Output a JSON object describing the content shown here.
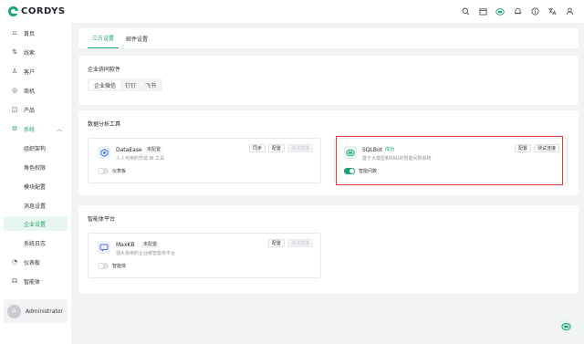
{
  "app": {
    "logo_text": "CORDYS"
  },
  "topbar": {
    "icons": [
      "search-icon",
      "calendar-icon",
      "sqlbot-icon",
      "bell-icon",
      "info-icon",
      "translate-icon",
      "user-icon"
    ]
  },
  "sidebar": {
    "items": [
      {
        "label": "首页",
        "icon": "home-icon"
      },
      {
        "label": "线索",
        "icon": "lead-icon"
      },
      {
        "label": "客户",
        "icon": "customer-icon"
      },
      {
        "label": "商机",
        "icon": "opportunity-icon"
      },
      {
        "label": "产品",
        "icon": "product-icon"
      },
      {
        "label": "系统",
        "icon": "settings-icon"
      }
    ],
    "sub_items": [
      {
        "label": "组织架构"
      },
      {
        "label": "角色权限"
      },
      {
        "label": "模块配置"
      },
      {
        "label": "消息设置"
      },
      {
        "label": "企业设置"
      },
      {
        "label": "系统日志"
      }
    ],
    "bottom_items": [
      {
        "label": "仪表板",
        "icon": "dashboard-icon"
      },
      {
        "label": "智能体",
        "icon": "agent-icon"
      }
    ],
    "user": {
      "avatar": "A",
      "name": "Administrator"
    }
  },
  "tabs": [
    {
      "label": "三方设置",
      "active": true
    },
    {
      "label": "邮件设置",
      "active": false
    }
  ],
  "section_collab": {
    "title": "企业协同软件",
    "options": [
      "企业微信",
      "钉钉",
      "飞书"
    ],
    "selected": "企业微信"
  },
  "section_analysis": {
    "title": "数据分析工具",
    "dataease": {
      "name": "DataEase",
      "tag": "未配置",
      "desc": "人人可用的开源 BI 工具",
      "buttons": [
        "同步",
        "配置",
        "测试连接"
      ],
      "toggle_label": "仪表板",
      "toggle_on": false
    },
    "sqlbot": {
      "name": "SQLBot",
      "tag": "成功",
      "desc": "基于大模型和RAG的智能问数系统",
      "buttons": [
        "配置",
        "测试连接"
      ],
      "toggle_label": "智能问数",
      "toggle_on": true
    }
  },
  "section_agent": {
    "title": "智能体平台",
    "maxkb": {
      "name": "MaxKB",
      "tag": "未配置",
      "desc": "强大易用的企业级智能体平台",
      "buttons": [
        "配置",
        "测试连接"
      ],
      "toggle_label": "智能体",
      "toggle_on": false
    }
  },
  "colors": {
    "accent": "#1aa36f",
    "highlight": "#e23b3b"
  }
}
